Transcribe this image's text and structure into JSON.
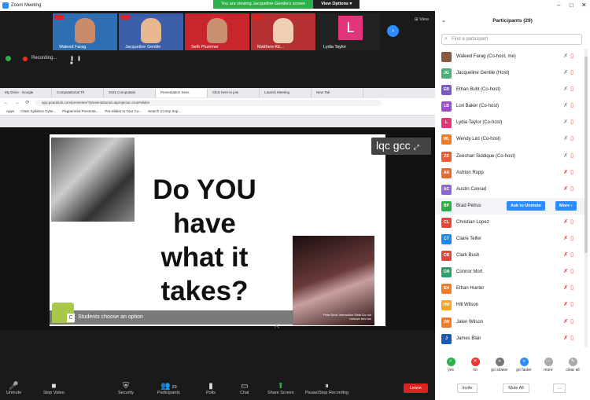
{
  "window": {
    "title": "Zoom Meeting"
  },
  "share_banner": {
    "text": "You are viewing Jacqueline Gentile's screen",
    "view_options": "View Options ▾"
  },
  "gallery": {
    "tiles": [
      {
        "name": "Waleed Farag",
        "bg": "#2e6fb3",
        "face": "#c98a6a"
      },
      {
        "name": "Jacqueline Gentile",
        "bg": "#3a5ea8",
        "face": "#e8b890"
      },
      {
        "name": "Seth Plummer",
        "bg": "#c8262c",
        "face": "#c79070"
      },
      {
        "name": "Matthew KE...",
        "bg": "#b53030",
        "face": "#eecfb5"
      },
      {
        "name": "Lydia Taylor",
        "letter": "L"
      }
    ],
    "view_label": "⊞ View"
  },
  "recording": {
    "text": "Recording..."
  },
  "browser": {
    "tabs": [
      "My Drive - Google",
      "Computational Th",
      "2021 Computatio",
      "Presentation Sess",
      "Click here to join",
      "Launch Meeting",
      "New Tab"
    ],
    "url": "app.peardeck.com/presenter/?presentationId=&projector=true#slides",
    "bookmarks": [
      "Apps",
      "Class Syllabus Cybe...",
      "Peppermint Presenta...",
      "Pre-Slides to Your Co...",
      "Search (Comp Sup..."
    ]
  },
  "slide": {
    "lines": [
      "Do YOU",
      "have",
      "what it",
      "takes?"
    ],
    "watermark": "lqc gcc",
    "peardeck_label": "Pear Deck Interactive Slide Do not remove this bar",
    "students_text": "Students choose an option",
    "student_icon_letter": "C"
  },
  "toolbar": {
    "items": [
      {
        "name": "unmute",
        "label": "Unmute",
        "icon": "🎤"
      },
      {
        "name": "stop-video",
        "label": "Stop Video",
        "icon": "■"
      },
      {
        "name": "security",
        "label": "Security",
        "icon": "⛨"
      },
      {
        "name": "participants",
        "label": "Participants",
        "icon": "👥",
        "count": "29"
      },
      {
        "name": "polls",
        "label": "Polls",
        "icon": "▮"
      },
      {
        "name": "chat",
        "label": "Chat",
        "icon": "▭"
      },
      {
        "name": "share-screen",
        "label": "Share Screen",
        "icon": "⬆"
      },
      {
        "name": "pause-recording",
        "label": "Pause/Stop Recording",
        "icon": "⏸"
      }
    ],
    "leave": "Leave"
  },
  "participants": {
    "title": "Participants (29)",
    "search_placeholder": "Find a participant",
    "list": [
      {
        "initials": "",
        "name": "Waleed Farag (Co-host, me)",
        "color": "#8a5a40"
      },
      {
        "initials": "JG",
        "name": "Jacqueline Gentile (Host)",
        "color": "#4caf7a"
      },
      {
        "initials": "EB",
        "name": "Ethan Buhl (Co-host)",
        "color": "#7e57c2"
      },
      {
        "initials": "LB",
        "name": "Lori Baker (Co-host)",
        "color": "#9c4fc9"
      },
      {
        "initials": "L",
        "name": "Lydia Taylor (Co-host)",
        "color": "#e2357a"
      },
      {
        "initials": "WL",
        "name": "Wendy Lint (Co-host)",
        "color": "#f07c2a"
      },
      {
        "initials": "ZS",
        "name": "Zeeshan Siddique (Co-host)",
        "color": "#e85d3a"
      },
      {
        "initials": "AR",
        "name": "Ashton Ropp",
        "color": "#e86a30"
      },
      {
        "initials": "AC",
        "name": "Austin Conrad",
        "color": "#8e6ad0"
      },
      {
        "initials": "BP",
        "name": "Brad Petrus",
        "color": "#2cb14a"
      },
      {
        "initials": "CL",
        "name": "Christian Lopez",
        "color": "#e5483a"
      },
      {
        "initials": "CT",
        "name": "Claire Telfer",
        "color": "#1e88e5"
      },
      {
        "initials": "CB",
        "name": "Clark Bush",
        "color": "#e5483a"
      },
      {
        "initials": "CM",
        "name": "Connor Mort",
        "color": "#2e9e6a"
      },
      {
        "initials": "EH",
        "name": "Ethan Hunter",
        "color": "#f07c2a"
      },
      {
        "initials": "HW",
        "name": "Hill Wilson",
        "color": "#f5a623"
      },
      {
        "initials": "JW",
        "name": "Jalen Wilson",
        "color": "#f07c2a"
      },
      {
        "initials": "J",
        "name": "James Blair",
        "color": "#1e5bb0"
      }
    ],
    "ask_unmute": "Ask to Unmute",
    "more": "More ›",
    "reactions": [
      {
        "label": "yes",
        "color": "#2cb14a",
        "glyph": "✓"
      },
      {
        "label": "no",
        "color": "#e33",
        "glyph": "✕"
      },
      {
        "label": "go slower",
        "color": "#777",
        "glyph": "«"
      },
      {
        "label": "go faster",
        "color": "#2d8cff",
        "glyph": "»"
      },
      {
        "label": "more",
        "color": "#aaa",
        "glyph": "⋯"
      },
      {
        "label": "clear all",
        "color": "#aaa",
        "glyph": "✎"
      }
    ],
    "invite": "Invite",
    "mute_all": "Mute All",
    "dots": "..."
  }
}
